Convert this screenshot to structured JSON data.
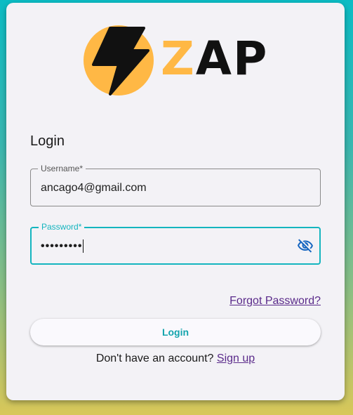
{
  "logo": {
    "text_left": "Z",
    "text_right": "AP",
    "icon": "lightning-bolt-icon"
  },
  "colors": {
    "accent": "#14b5bf",
    "brand_yellow": "#ffb845",
    "link": "#5a2a8a"
  },
  "form": {
    "title": "Login",
    "username": {
      "label": "Username*",
      "value": "ancago4@gmail.com"
    },
    "password": {
      "label": "Password*",
      "value": "•••••••••",
      "toggle_icon": "eye-off-icon"
    },
    "forgot_label": "Forgot Password?",
    "login_label": "Login",
    "signup_prompt": "Don't have an account?",
    "signup_label": "Sign up"
  }
}
